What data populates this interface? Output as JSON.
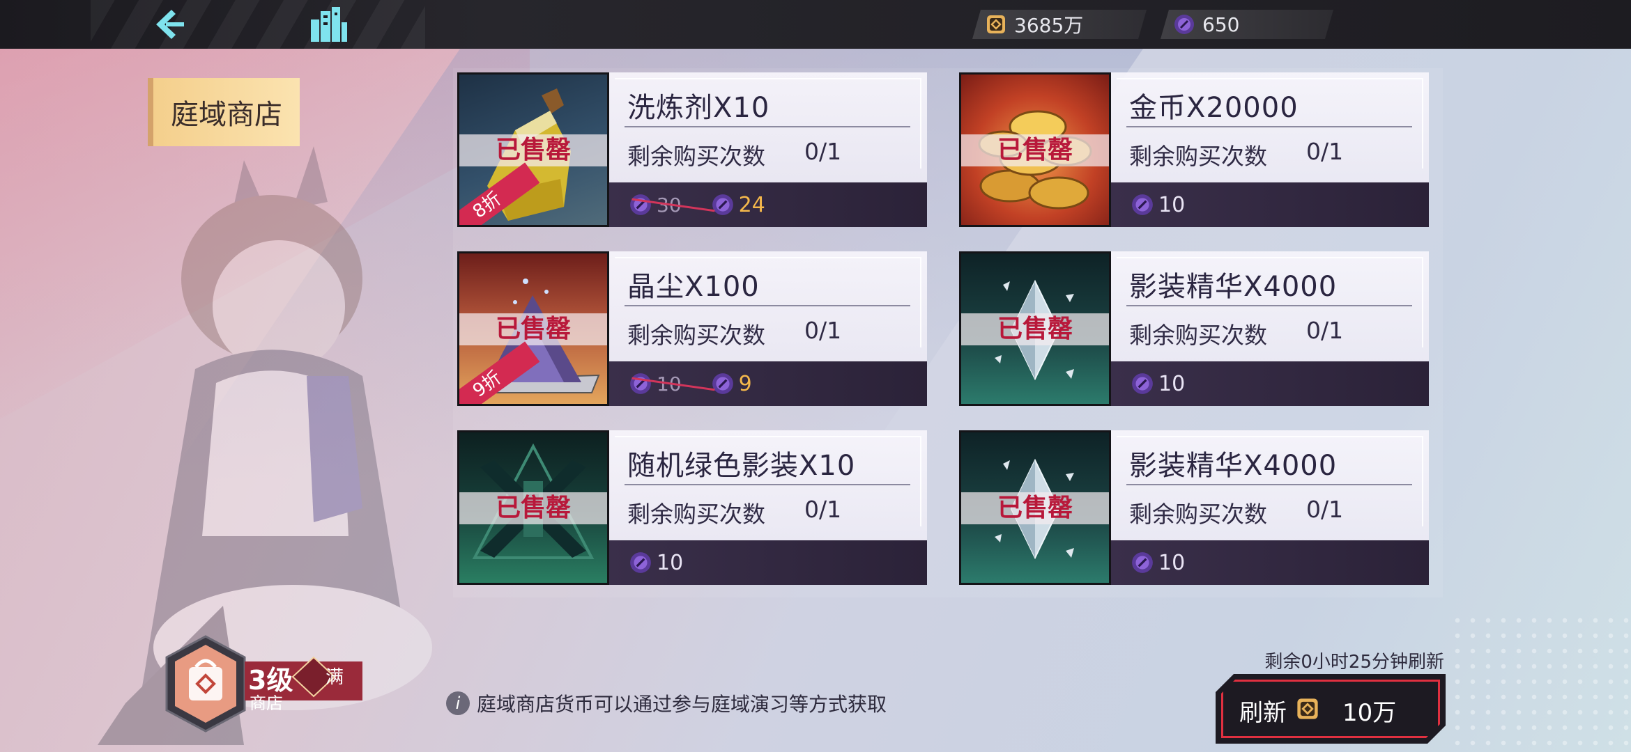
{
  "topbar": {
    "back_icon": "back-chevron-icon",
    "home_icon": "city-buildings-icon",
    "currencies": [
      {
        "icon": "gold-coin-icon",
        "amount": "3685万"
      },
      {
        "icon": "purple-gem-icon",
        "amount": "650"
      }
    ]
  },
  "shop": {
    "title": "庭域商店"
  },
  "items": [
    {
      "name": "洗炼剂X10",
      "limit_label": "剩余购买次数",
      "limit": "0/1",
      "sold_out": "已售罄",
      "discount": "8折",
      "old_price": "30",
      "price": "24",
      "thumb": "oil-bottle-icon"
    },
    {
      "name": "金币X20000",
      "limit_label": "剩余购买次数",
      "limit": "0/1",
      "sold_out": "已售罄",
      "price": "10",
      "thumb": "gold-coins-icon"
    },
    {
      "name": "晶尘X100",
      "limit_label": "剩余购买次数",
      "limit": "0/1",
      "sold_out": "已售罄",
      "discount": "9折",
      "old_price": "10",
      "price": "9",
      "thumb": "crystal-dust-icon"
    },
    {
      "name": "影装精华X4000",
      "limit_label": "剩余购买次数",
      "limit": "0/1",
      "sold_out": "已售罄",
      "price": "10",
      "thumb": "crystal-shard-icon"
    },
    {
      "name": "随机绿色影装X10",
      "limit_label": "剩余购买次数",
      "limit": "0/1",
      "sold_out": "已售罄",
      "price": "10",
      "thumb": "green-gear-icon"
    },
    {
      "name": "影装精华X4000",
      "limit_label": "剩余购买次数",
      "limit": "0/1",
      "sold_out": "已售罄",
      "price": "10",
      "thumb": "crystal-shard-icon"
    }
  ],
  "level": {
    "level": "3级",
    "label": "商店",
    "status": "满"
  },
  "tip": "庭域商店货币可以通过参与庭域演习等方式获取",
  "refresh": {
    "timer": "剩余0小时25分钟刷新",
    "label": "刷新",
    "cost": "10万"
  },
  "colors": {
    "sold_out": "#b8183a",
    "discount_tag": "#d32a51",
    "price_discounted": "#f5b84b",
    "shop_tag": "#f4cf8c",
    "refresh_border": "#e03040"
  }
}
